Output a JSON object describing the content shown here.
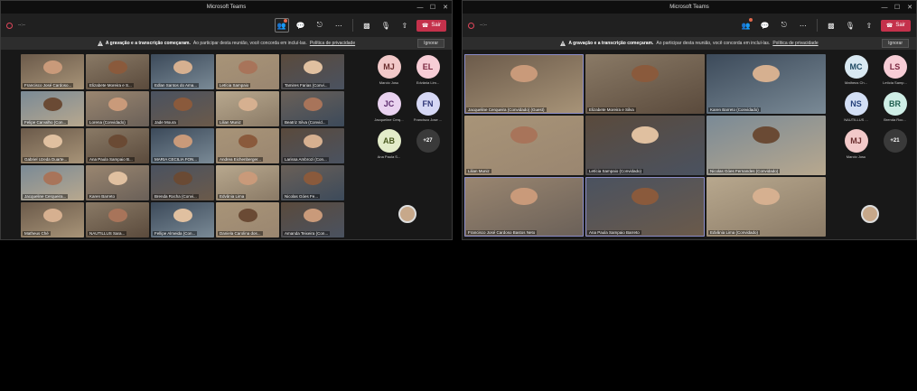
{
  "app_title": "Microsoft Teams",
  "timer": "--:--",
  "toolbar": {
    "leave_label": "Sair",
    "chat_badge": "1"
  },
  "banner": {
    "bold": "A gravação e a transcrição começaram.",
    "text": "Ao participar desta reunião, você concorda em incluí-las.",
    "link": "Política de privacidade",
    "ignore": "Ignorar"
  },
  "left": {
    "tiles": [
      {
        "label": "Francisco José Cardoso..."
      },
      {
        "label": "Elizabete Moreira e S..."
      },
      {
        "label": "Edlan Santos do Ama..."
      },
      {
        "label": "Letícia Sampaio"
      },
      {
        "label": "Tamires Farias (Convi..."
      },
      {
        "label": "Felipe Carvalho (Con..."
      },
      {
        "label": "Lorena (Convidado)"
      },
      {
        "label": "Jade Moura"
      },
      {
        "label": "Lilian Muniz"
      },
      {
        "label": "Beatriz Silva (Convid..."
      },
      {
        "label": "Gabriel Uzeda Duarte..."
      },
      {
        "label": "Ana Paula Sampaio B..."
      },
      {
        "label": "MARIA CECILIA FON..."
      },
      {
        "label": "Andrea Eichenberger..."
      },
      {
        "label": "Larissa Ambrozi (Con..."
      },
      {
        "label": "Jacqueline Cerqueira..."
      },
      {
        "label": "Karen Barreto"
      },
      {
        "label": "Brenda Rocha (Convi..."
      },
      {
        "label": "Edvânia Lima"
      },
      {
        "label": "Nicolas Góes Fe..."
      },
      {
        "label": "Matheus Ché"
      },
      {
        "label": "NAUTILLUS Sara..."
      },
      {
        "label": "Fellipe Almeida (Con..."
      },
      {
        "label": "Daniela Carolina dos..."
      },
      {
        "label": "Amanda Teixeira (Con..."
      }
    ],
    "roster": [
      {
        "initials": "MJ",
        "name": "Marcio Josu",
        "bg": "#f2c9c9",
        "fg": "#6b2f2f"
      },
      {
        "initials": "EL",
        "name": "Edvânia Lim...",
        "bg": "#f7cdd6",
        "fg": "#7a2740"
      },
      {
        "initials": "JC",
        "name": "Jacqueline Cerq...",
        "bg": "#e9d2f0",
        "fg": "#5e2c6e"
      },
      {
        "initials": "FN",
        "name": "Francisco Jose ...",
        "bg": "#d6d8f5",
        "fg": "#2f3677"
      },
      {
        "initials": "AB",
        "name": "Ana Paula S...",
        "bg": "#e3ecc9",
        "fg": "#4a5a1f"
      },
      {
        "initials": "+27",
        "name": "",
        "bg": "#3a3a3a",
        "fg": "#fff"
      }
    ]
  },
  "right": {
    "tiles": [
      {
        "label": "Jacqueline Cerqueira (Convidado) (Guest)"
      },
      {
        "label": "Elizabete Moreira e Silva"
      },
      {
        "label": "Karen Barreto (Convidado)"
      },
      {
        "label": "Lilian Muniz"
      },
      {
        "label": "Letícia Sampaio (Convidado)"
      },
      {
        "label": "Nicolas Góes Fernandes (Convidado)"
      },
      {
        "label": "Francisco José Cardoso Bastos Neto"
      },
      {
        "label": "Ana Paula Sampaio Barreto"
      },
      {
        "label": "Edvânia Lima (Convidado)"
      }
    ],
    "roster": [
      {
        "initials": "MC",
        "name": "Matheus Ch...",
        "bg": "#d9e9f2",
        "fg": "#1f4a63"
      },
      {
        "initials": "LS",
        "name": "Letícia Samp...",
        "bg": "#f7cdd6",
        "fg": "#7a2740"
      },
      {
        "initials": "NS",
        "name": "NAUTILLUS ...",
        "bg": "#d3dff5",
        "fg": "#24407a"
      },
      {
        "initials": "BR",
        "name": "Brenda Roc...",
        "bg": "#cfeee6",
        "fg": "#1f5e4f"
      },
      {
        "initials": "MJ",
        "name": "Marcio Josu",
        "bg": "#f2c9c9",
        "fg": "#6b2f2f"
      },
      {
        "initials": "+21",
        "name": "",
        "bg": "#3a3a3a",
        "fg": "#fff"
      }
    ]
  }
}
